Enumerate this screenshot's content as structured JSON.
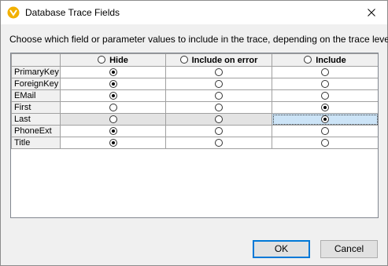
{
  "window": {
    "title": "Database Trace Fields",
    "icon": "altova-mapforce-icon"
  },
  "instructions": "Choose which field or parameter values to include in the trace, depending on the trace level:",
  "columns": [
    "Hide",
    "Include on error",
    "Include"
  ],
  "rows": [
    {
      "name": "PrimaryKey",
      "selected": 0
    },
    {
      "name": "ForeignKey",
      "selected": 0
    },
    {
      "name": "EMail",
      "selected": 0
    },
    {
      "name": "First",
      "selected": 2
    },
    {
      "name": "Last",
      "selected": 2
    },
    {
      "name": "PhoneExt",
      "selected": 0
    },
    {
      "name": "Title",
      "selected": 0
    }
  ],
  "highlighted_row": "Last",
  "buttons": {
    "ok": "OK",
    "cancel": "Cancel"
  },
  "colors": {
    "selection": "#cce4f7",
    "focus_border": "#0078d7",
    "title_icon": "#f2b000"
  }
}
